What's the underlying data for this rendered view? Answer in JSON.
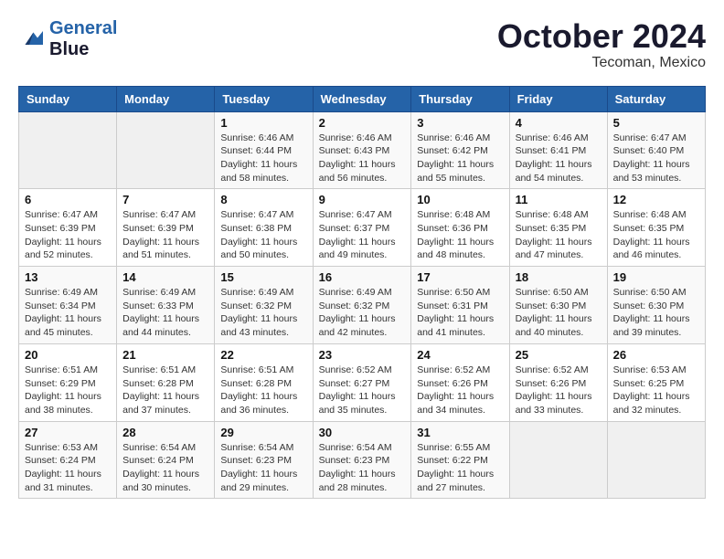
{
  "logo": {
    "text_general": "General",
    "text_blue": "Blue"
  },
  "title": {
    "month_year": "October 2024",
    "location": "Tecoman, Mexico"
  },
  "header_days": [
    "Sunday",
    "Monday",
    "Tuesday",
    "Wednesday",
    "Thursday",
    "Friday",
    "Saturday"
  ],
  "weeks": [
    [
      {
        "day": null,
        "info": null
      },
      {
        "day": null,
        "info": null
      },
      {
        "day": "1",
        "info": "Sunrise: 6:46 AM\nSunset: 6:44 PM\nDaylight: 11 hours and 58 minutes."
      },
      {
        "day": "2",
        "info": "Sunrise: 6:46 AM\nSunset: 6:43 PM\nDaylight: 11 hours and 56 minutes."
      },
      {
        "day": "3",
        "info": "Sunrise: 6:46 AM\nSunset: 6:42 PM\nDaylight: 11 hours and 55 minutes."
      },
      {
        "day": "4",
        "info": "Sunrise: 6:46 AM\nSunset: 6:41 PM\nDaylight: 11 hours and 54 minutes."
      },
      {
        "day": "5",
        "info": "Sunrise: 6:47 AM\nSunset: 6:40 PM\nDaylight: 11 hours and 53 minutes."
      }
    ],
    [
      {
        "day": "6",
        "info": "Sunrise: 6:47 AM\nSunset: 6:39 PM\nDaylight: 11 hours and 52 minutes."
      },
      {
        "day": "7",
        "info": "Sunrise: 6:47 AM\nSunset: 6:39 PM\nDaylight: 11 hours and 51 minutes."
      },
      {
        "day": "8",
        "info": "Sunrise: 6:47 AM\nSunset: 6:38 PM\nDaylight: 11 hours and 50 minutes."
      },
      {
        "day": "9",
        "info": "Sunrise: 6:47 AM\nSunset: 6:37 PM\nDaylight: 11 hours and 49 minutes."
      },
      {
        "day": "10",
        "info": "Sunrise: 6:48 AM\nSunset: 6:36 PM\nDaylight: 11 hours and 48 minutes."
      },
      {
        "day": "11",
        "info": "Sunrise: 6:48 AM\nSunset: 6:35 PM\nDaylight: 11 hours and 47 minutes."
      },
      {
        "day": "12",
        "info": "Sunrise: 6:48 AM\nSunset: 6:35 PM\nDaylight: 11 hours and 46 minutes."
      }
    ],
    [
      {
        "day": "13",
        "info": "Sunrise: 6:49 AM\nSunset: 6:34 PM\nDaylight: 11 hours and 45 minutes."
      },
      {
        "day": "14",
        "info": "Sunrise: 6:49 AM\nSunset: 6:33 PM\nDaylight: 11 hours and 44 minutes."
      },
      {
        "day": "15",
        "info": "Sunrise: 6:49 AM\nSunset: 6:32 PM\nDaylight: 11 hours and 43 minutes."
      },
      {
        "day": "16",
        "info": "Sunrise: 6:49 AM\nSunset: 6:32 PM\nDaylight: 11 hours and 42 minutes."
      },
      {
        "day": "17",
        "info": "Sunrise: 6:50 AM\nSunset: 6:31 PM\nDaylight: 11 hours and 41 minutes."
      },
      {
        "day": "18",
        "info": "Sunrise: 6:50 AM\nSunset: 6:30 PM\nDaylight: 11 hours and 40 minutes."
      },
      {
        "day": "19",
        "info": "Sunrise: 6:50 AM\nSunset: 6:30 PM\nDaylight: 11 hours and 39 minutes."
      }
    ],
    [
      {
        "day": "20",
        "info": "Sunrise: 6:51 AM\nSunset: 6:29 PM\nDaylight: 11 hours and 38 minutes."
      },
      {
        "day": "21",
        "info": "Sunrise: 6:51 AM\nSunset: 6:28 PM\nDaylight: 11 hours and 37 minutes."
      },
      {
        "day": "22",
        "info": "Sunrise: 6:51 AM\nSunset: 6:28 PM\nDaylight: 11 hours and 36 minutes."
      },
      {
        "day": "23",
        "info": "Sunrise: 6:52 AM\nSunset: 6:27 PM\nDaylight: 11 hours and 35 minutes."
      },
      {
        "day": "24",
        "info": "Sunrise: 6:52 AM\nSunset: 6:26 PM\nDaylight: 11 hours and 34 minutes."
      },
      {
        "day": "25",
        "info": "Sunrise: 6:52 AM\nSunset: 6:26 PM\nDaylight: 11 hours and 33 minutes."
      },
      {
        "day": "26",
        "info": "Sunrise: 6:53 AM\nSunset: 6:25 PM\nDaylight: 11 hours and 32 minutes."
      }
    ],
    [
      {
        "day": "27",
        "info": "Sunrise: 6:53 AM\nSunset: 6:24 PM\nDaylight: 11 hours and 31 minutes."
      },
      {
        "day": "28",
        "info": "Sunrise: 6:54 AM\nSunset: 6:24 PM\nDaylight: 11 hours and 30 minutes."
      },
      {
        "day": "29",
        "info": "Sunrise: 6:54 AM\nSunset: 6:23 PM\nDaylight: 11 hours and 29 minutes."
      },
      {
        "day": "30",
        "info": "Sunrise: 6:54 AM\nSunset: 6:23 PM\nDaylight: 11 hours and 28 minutes."
      },
      {
        "day": "31",
        "info": "Sunrise: 6:55 AM\nSunset: 6:22 PM\nDaylight: 11 hours and 27 minutes."
      },
      {
        "day": null,
        "info": null
      },
      {
        "day": null,
        "info": null
      }
    ]
  ]
}
